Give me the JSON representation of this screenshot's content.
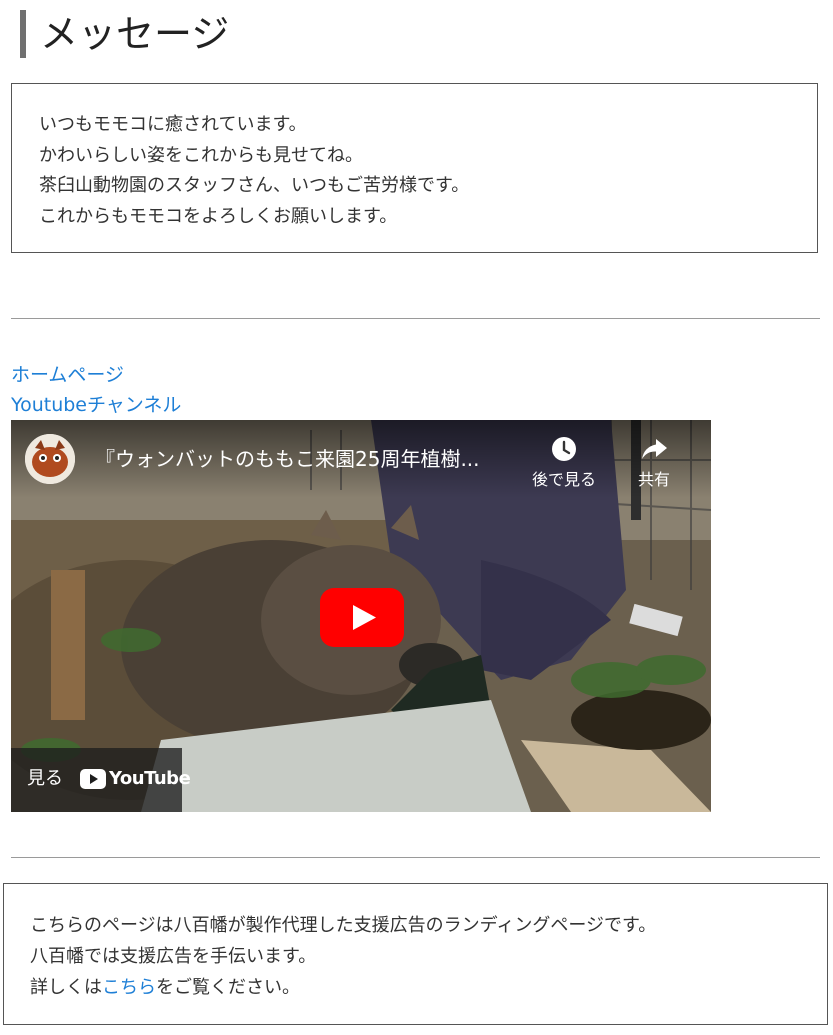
{
  "page": {
    "title": "メッセージ"
  },
  "message": {
    "lines": [
      "いつもモモコに癒されています。",
      "かわいらしい姿をこれからも見せてね。",
      "茶臼山動物園のスタッフさん、いつもご苦労様です。",
      "これからもモモコをよろしくお願いします。"
    ]
  },
  "links": {
    "homepage": "ホームページ",
    "youtube_channel": "Youtubeチャンネル"
  },
  "video": {
    "title": "『ウォンバットのももこ来園25周年植樹...",
    "watch_later_label": "後で見る",
    "share_label": "共有",
    "watch_on_label": "見る",
    "youtube_label": "YouTube",
    "icons": [
      "channel-avatar",
      "clock-icon",
      "share-icon",
      "play-icon",
      "youtube-logo-icon"
    ]
  },
  "footer": {
    "line1": "こちらのページは八百幡が製作代理した支援広告のランディングページです。",
    "line2": "八百幡では支援広告を手伝います。",
    "line3_before": "詳しくは",
    "line3_link": "こちら",
    "line3_after": "をご覧ください。"
  },
  "colors": {
    "link": "#1e7fd6",
    "youtube_red": "#ff0000",
    "title_bar": "#707070",
    "border": "#555555"
  }
}
